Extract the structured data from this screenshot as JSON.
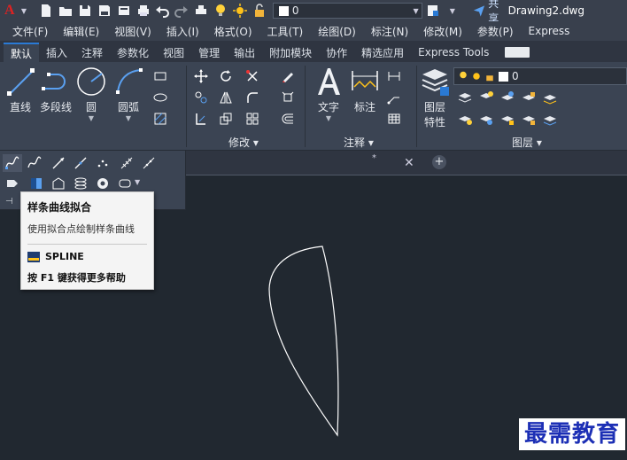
{
  "titlebar": {
    "layer_value": "0",
    "share_label": "共享",
    "document_title": "Drawing2.dwg"
  },
  "menu": [
    "文件(F)",
    "编辑(E)",
    "视图(V)",
    "插入(I)",
    "格式(O)",
    "工具(T)",
    "绘图(D)",
    "标注(N)",
    "修改(M)",
    "参数(P)",
    "Express"
  ],
  "tabs": [
    "默认",
    "插入",
    "注释",
    "参数化",
    "视图",
    "管理",
    "输出",
    "附加模块",
    "协作",
    "精选应用",
    "Express Tools"
  ],
  "ribbon": {
    "draw": {
      "line": "直线",
      "polyline": "多段线",
      "circle": "圆",
      "arc": "圆弧"
    },
    "modify": {
      "title": "修改"
    },
    "annotation": {
      "text": "文字",
      "dimension": "标注",
      "title": "注释"
    },
    "layers": {
      "properties_line1": "图层",
      "properties_line2": "特性",
      "title": "图层",
      "layer_value": "0"
    }
  },
  "tooltip": {
    "title": "样条曲线拟合",
    "description": "使用拟合点绘制样条曲线",
    "command": "SPLINE",
    "help": "按 F1 键获得更多帮助"
  },
  "colors": {
    "accent": "#2a7ad5",
    "background": "#212830",
    "ribbon": "#3b4453",
    "brand_red": "#dd2222"
  },
  "watermark": "最需教育"
}
